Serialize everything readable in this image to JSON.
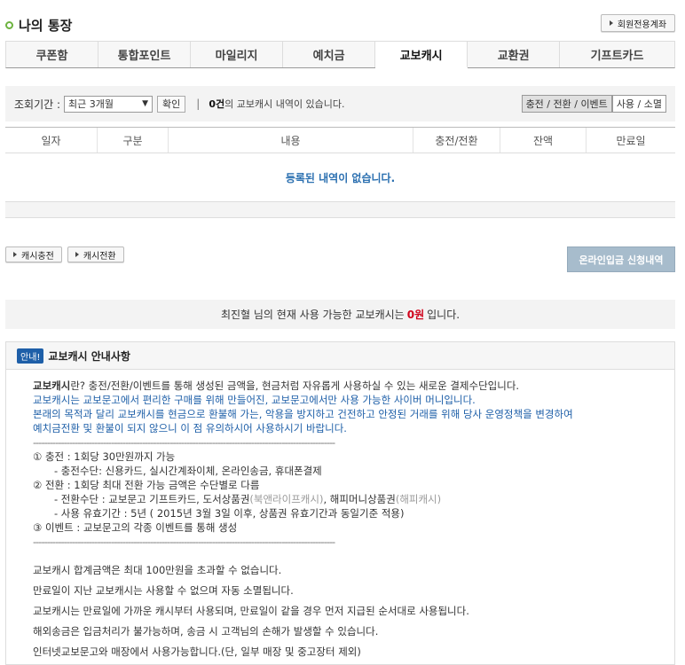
{
  "header": {
    "title": "나의 통장",
    "member_button": "회원전용계좌"
  },
  "tabs": [
    {
      "label": "쿠폰함",
      "active": false
    },
    {
      "label": "통합포인트",
      "active": false
    },
    {
      "label": "마일리지",
      "active": false
    },
    {
      "label": "예치금",
      "active": false
    },
    {
      "label": "교보캐시",
      "active": true
    },
    {
      "label": "교환권",
      "active": false
    },
    {
      "label": "기프트카드",
      "active": false
    }
  ],
  "filter": {
    "label": "조회기간 :",
    "period_value": "최근 3개월",
    "confirm_label": "확인",
    "separator": "|",
    "count_bold": "0건",
    "count_text": "의 교보캐시 내역이 있습니다.",
    "toggle_charge": "충전 / 전환 / 이벤트",
    "toggle_use": "사용 / 소멸"
  },
  "table": {
    "columns": [
      "일자",
      "구분",
      "내용",
      "충전/전환",
      "잔액",
      "만료일"
    ],
    "empty_message": "등록된 내역이 없습니다."
  },
  "actions": {
    "charge_label": "캐시충전",
    "convert_label": "캐시전환",
    "apply_list_label": "온라인입금 신청내역"
  },
  "balance": {
    "prefix": "최진혈 님의 현재 사용 가능한 교보캐시는",
    "amount": "0원",
    "suffix": "입니다."
  },
  "notice": {
    "badge": "안내!",
    "title": "교보캐시 안내사항",
    "intro_bold": "교보캐시",
    "intro_rest": "란? 충전/전환/이벤트를 통해 생성된 금액을, 현금처럼 자유롭게 사용하실 수 있는 새로운 결제수단입니다.",
    "blue_line1": "교보캐시는 교보문고에서 편리한 구매를 위해 만들어진, 교보문고에서만 사용 가능한 사이버 머니입니다.",
    "blue_line2": "본래의 목적과 달리 교보캐시를 현금으로 환불해 가는, 악용을 방지하고 건전하고 안정된 거래를 위해 당사 운영정책을 변경하여",
    "blue_line3": "예치금전환 및 환불이 되지 않으니 이 점 유의하시어 사용하시기 바랍니다.",
    "divider": "------------------------------------------------------------------------------------------------------------",
    "item1": "① 충전 : 1회당 30만원까지 가능",
    "item1_sub": "- 충전수단: 신용카드, 실시간계좌이체, 온라인송금, 휴대폰결제",
    "item2": "② 전환 : 1회당 최대 전환 가능 금액은 수단별로 다름",
    "item2_sub1_a": "- 전환수단 : 교보문고 기프트카드, 도서상품권",
    "item2_sub1_b": "(북앤라이프캐시)",
    "item2_sub1_c": ", 해피머니상품권",
    "item2_sub1_d": "(해피캐시)",
    "item2_sub2": "- 사용 유효기간 : 5년 ( 2015년 3월 3일 이후, 상품권 유효기간과 동일기준 적용)",
    "item3": "③ 이벤트 : 교보문고의 각종 이벤트를 통해 생성",
    "foot": [
      "교보캐시 합계금액은 최대 100만원을 초과할 수 없습니다.",
      "만료일이 지난 교보캐시는 사용할 수 없으며 자동 소멸됩니다.",
      "교보캐시는 만료일에 가까운 캐시부터 사용되며, 만료일이 같을 경우 먼저 지급된 순서대로 사용됩니다.",
      "해외송금은 입금처리가 불가능하며, 송금 시 고객님의 손해가 발생할 수 있습니다.",
      "인터넷교보문고와 매장에서 사용가능합니다.(단, 일부 매장 및 중고장터 제외)"
    ]
  }
}
